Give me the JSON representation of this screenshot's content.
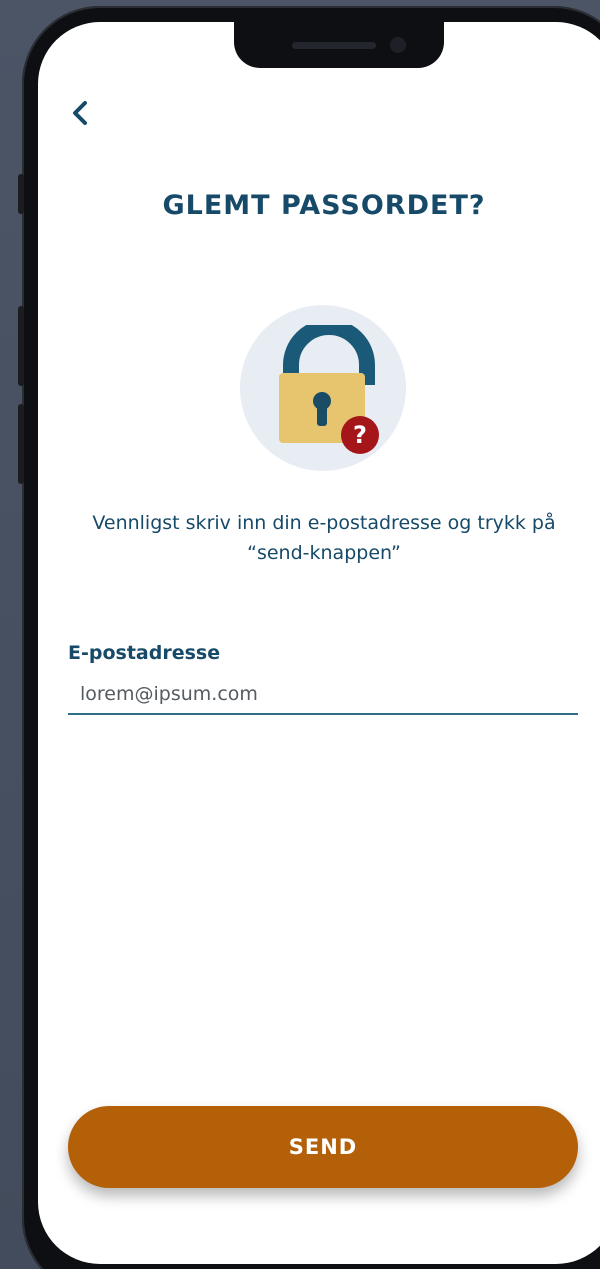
{
  "header": {
    "back_icon": "chevron-left-icon",
    "title": "GLEMT PASSORDET?"
  },
  "illustration": {
    "icon": "lock-question-icon",
    "badge_text": "?"
  },
  "instruction": {
    "text": "Vennligst skriv inn din e-postadresse og trykk på “send-knappen”"
  },
  "email": {
    "label": "E-postadresse",
    "value": "lorem@ipsum.com",
    "placeholder": ""
  },
  "actions": {
    "send_label": "SEND"
  },
  "colors": {
    "primary": "#164a68",
    "accent": "#b36009",
    "lock_body": "#e6c56e",
    "badge": "#a4161a",
    "circle_bg": "#e8edf3"
  }
}
